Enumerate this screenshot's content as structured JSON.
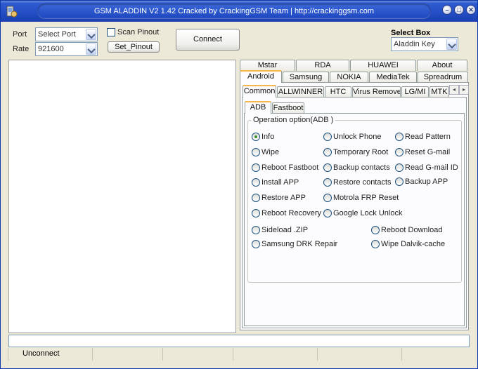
{
  "window": {
    "title": "GSM ALADDIN V2 1.42 Cracked by CrackingGSM Team | http://crackinggsm.com",
    "minimize_glyph": "–",
    "maximize_glyph": "□",
    "close_glyph": "✕"
  },
  "connection": {
    "port_label": "Port",
    "port_value": "Select Port",
    "rate_label": "Rate",
    "rate_value": "921600",
    "scan_pinout_label": "Scan Pinout",
    "set_pinout_label": "Set_Pinout",
    "connect_label": "Connect"
  },
  "select_box": {
    "label": "Select Box",
    "value": "Aladdin Key"
  },
  "brand_tabs_row1": [
    "Mstar",
    "RDA",
    "HUAWEI",
    "About"
  ],
  "brand_tabs_row2": [
    "Android",
    "Samsung",
    "NOKIA",
    "MediaTek",
    "Spreadrum"
  ],
  "sub_tabs": [
    "Common",
    "ALLWINNER",
    "HTC",
    "Virus Remove",
    "LG/MI",
    "MTK"
  ],
  "mode_tabs": [
    "ADB",
    "Fastboot"
  ],
  "operation": {
    "group_title": "Operation option(ADB )",
    "options": [
      "Info",
      "Unlock Phone",
      "Read Pattern",
      "Wipe",
      "Temporary Root",
      "Reset G-mail",
      "Reboot Fastboot",
      "Backup contacts",
      "Read G-mail ID",
      "Install APP",
      "Restore contacts",
      "Backup APP",
      "Restore APP",
      "Motrola FRP Reset",
      "Reboot Recovery",
      "Google Lock Unlock",
      "Sideload .ZIP",
      "Reboot Download",
      "Samsung DRK Repair",
      "Wipe Dalvik-cache"
    ],
    "selected": "Info"
  },
  "status": {
    "connection_state": "Unconnect"
  },
  "icons": {
    "app": "app-icon",
    "scroll_left": "◂",
    "scroll_right": "▸"
  }
}
